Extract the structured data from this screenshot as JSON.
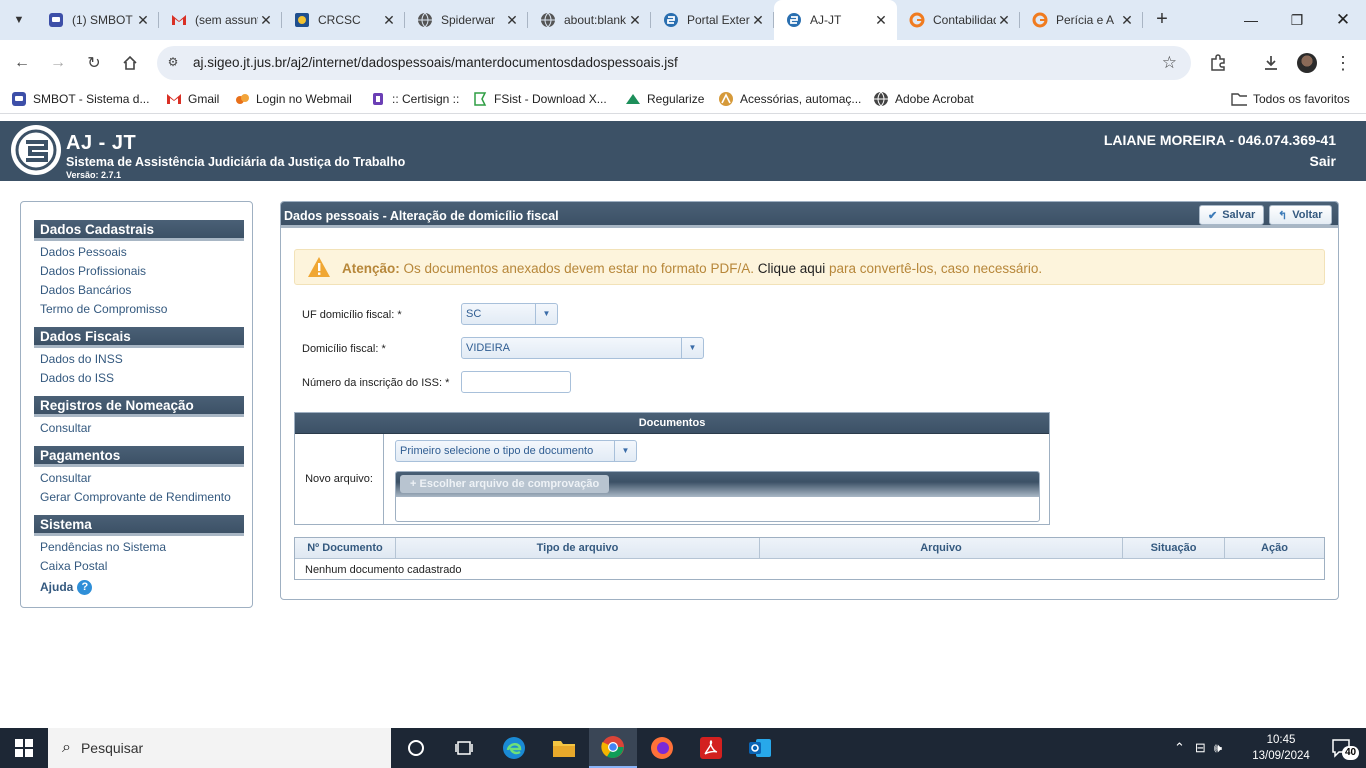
{
  "browser": {
    "tabs": [
      {
        "title": "(1) SMBOT",
        "icon": "smbot-icon",
        "active": false
      },
      {
        "title": "(sem assunto)",
        "icon": "gmail-icon",
        "active": false
      },
      {
        "title": "CRCSC",
        "icon": "crcsc-icon",
        "active": false
      },
      {
        "title": "Spiderwar",
        "icon": "globe-icon",
        "active": false
      },
      {
        "title": "about:blank",
        "icon": "globe-icon",
        "active": false
      },
      {
        "title": "Portal Externo",
        "icon": "sigeo-icon",
        "active": false
      },
      {
        "title": "AJ-JT",
        "icon": "sigeo-icon",
        "active": true
      },
      {
        "title": "Contabilidade",
        "icon": "g-icon",
        "active": false
      },
      {
        "title": "Perícia e A",
        "icon": "g-icon",
        "active": false
      }
    ],
    "url": "aj.sigeo.jt.jus.br/aj2/internet/dadospessoais/manterdocumentosdadospessoais.jsf",
    "bookmarks": [
      {
        "label": "SMBOT - Sistema d...",
        "icon": "smbot-icon"
      },
      {
        "label": "Gmail",
        "icon": "gmail-icon"
      },
      {
        "label": "Login no Webmail",
        "icon": "webmail-icon"
      },
      {
        "label": ":: Certisign ::",
        "icon": "certisign-icon"
      },
      {
        "label": "FSist - Download X...",
        "icon": "fsist-icon"
      },
      {
        "label": "Regularize",
        "icon": "regularize-icon"
      },
      {
        "label": "Acessórias, automaç...",
        "icon": "acessorias-icon"
      },
      {
        "label": "Adobe Acrobat",
        "icon": "globe-icon"
      }
    ],
    "all_bookmarks_label": "Todos os favoritos"
  },
  "app": {
    "title": "AJ - JT",
    "subtitle": "Sistema de Assistência Judiciária da Justiça do Trabalho",
    "version": "Versão: 2.7.1",
    "user": "LAIANE MOREIRA - 046.074.369-41",
    "logout": "Sair"
  },
  "sidebar": {
    "groups": [
      {
        "title": "Dados Cadastrais",
        "items": [
          "Dados Pessoais",
          "Dados Profissionais",
          "Dados Bancários",
          "Termo de Compromisso"
        ]
      },
      {
        "title": "Dados Fiscais",
        "items": [
          "Dados do INSS",
          "Dados do ISS"
        ]
      },
      {
        "title": "Registros de Nomeação",
        "items": [
          "Consultar"
        ]
      },
      {
        "title": "Pagamentos",
        "items": [
          "Consultar",
          "Gerar Comprovante de Rendimento"
        ]
      },
      {
        "title": "Sistema",
        "items": [
          "Pendências no Sistema",
          "Caixa Postal"
        ]
      }
    ],
    "help_label": "Ajuda"
  },
  "panel": {
    "title": "Dados pessoais - Alteração de domicílio fiscal",
    "save_label": "Salvar",
    "back_label": "Voltar",
    "alert": {
      "prefix": "Atenção:",
      "text": "Os documentos anexados devem estar no formato PDF/A.",
      "link": "Clique aqui",
      "suffix": "para convertê-los, caso necessário."
    },
    "fields": {
      "uf_label": "UF domicílio fiscal: *",
      "uf_value": "SC",
      "domicilio_label": "Domicílio fiscal: *",
      "domicilio_value": "VIDEIRA",
      "iss_label": "Número da inscrição do ISS: *",
      "iss_value": ""
    },
    "documents": {
      "title": "Documentos",
      "new_file_label": "Novo arquivo:",
      "type_placeholder": "Primeiro selecione o tipo de documento",
      "choose_file_label": "Escolher arquivo de comprovação"
    },
    "table": {
      "columns": [
        "Nº Documento",
        "Tipo de arquivo",
        "Arquivo",
        "Situação",
        "Ação"
      ],
      "empty_text": "Nenhum documento cadastrado"
    }
  },
  "taskbar": {
    "search_placeholder": "Pesquisar",
    "time": "10:45",
    "date": "13/09/2024",
    "notification_count": "40"
  },
  "colors": {
    "header_bg": "#3c5166",
    "link": "#34597f",
    "alert_bg": "#fdf4dc",
    "alert_text": "#b7873a"
  }
}
